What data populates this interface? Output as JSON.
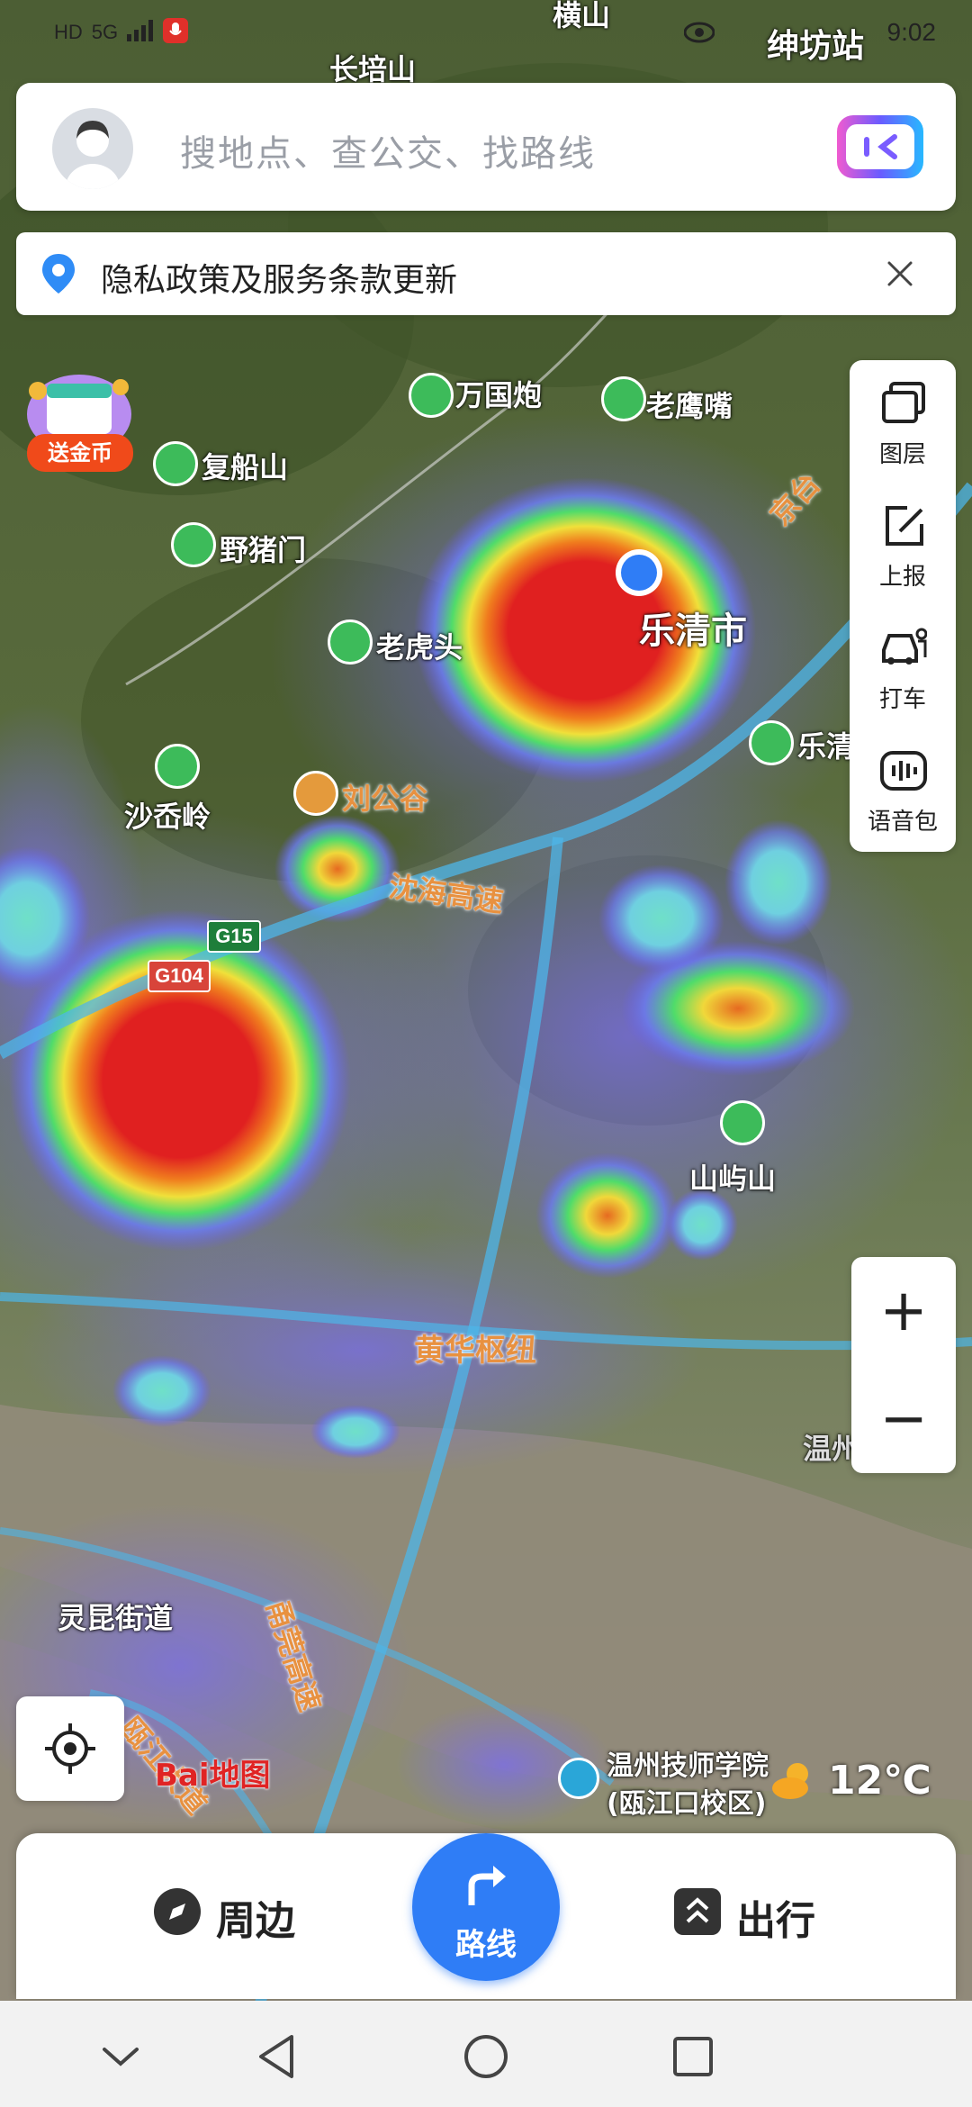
{
  "status_bar": {
    "left_items": [
      "HD",
      "5G",
      "signal-icon",
      "mic-icon"
    ],
    "right_text": "9:02"
  },
  "search": {
    "placeholder": "搜地点、查公交、找路线"
  },
  "notice": {
    "text": "隐私政策及服务条款更新"
  },
  "coin_badge": {
    "label": "送金币"
  },
  "right_toolbar": [
    {
      "label": "图层",
      "icon": "layers-icon"
    },
    {
      "label": "上报",
      "icon": "report-icon"
    },
    {
      "label": "打车",
      "icon": "taxi-icon"
    },
    {
      "label": "语音包",
      "icon": "voice-pack-icon"
    }
  ],
  "zoom": {
    "in": "+",
    "out": "−"
  },
  "map_labels": {
    "hengshan": "横山",
    "changpeishan": "长培山",
    "station": "绅坊站",
    "wanguopao": "万国炮",
    "laoyingzui": "老鹰嘴",
    "fuchuanshan": "复船山",
    "yezhumen": "野猪门",
    "laohutou": "老虎头",
    "yueqingshi": "乐清市",
    "shadianling": "沙岙岭",
    "liugonggu": "刘公谷",
    "shenhai": "沈海高速",
    "g15": "G15",
    "g104": "G104",
    "jingtai": "京台",
    "yueqing_right": "乐清",
    "shanyushan": "山屿山",
    "huanghuashuniu": "黄华枢纽",
    "wenzhou": "温州",
    "lingkunjiedao": "灵昆街道",
    "nanfang": "甬莞高速",
    "oujiang": "瓯江大道",
    "school_line1": "温州技师学院",
    "school_line2": "(瓯江口校区)"
  },
  "baidu_logo": "Bai地图",
  "weather": {
    "temp": "12℃"
  },
  "bottom_bar": {
    "left": "周边",
    "center": "路线",
    "right": "出行"
  }
}
